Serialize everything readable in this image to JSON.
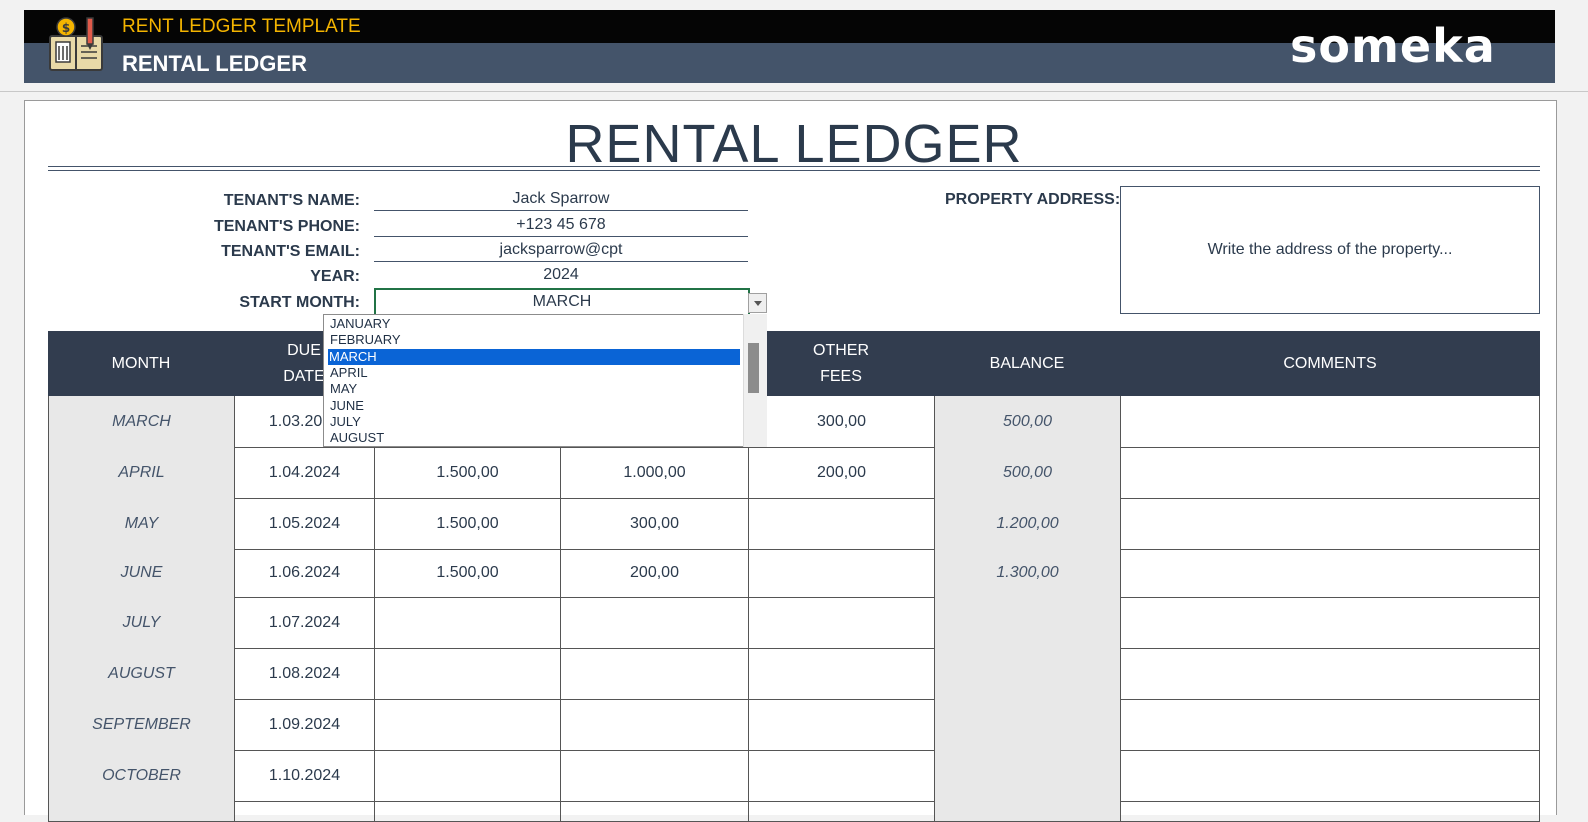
{
  "header": {
    "subtitle": "RENT LEDGER TEMPLATE",
    "title": "RENTAL LEDGER",
    "brand": "someka",
    "logo_icon": "ledger-book-icon"
  },
  "sheet_title": "RENTAL LEDGER",
  "tenant": {
    "name_label": "TENANT'S NAME:",
    "name": "Jack Sparrow",
    "phone_label": "TENANT'S PHONE:",
    "phone": "+123 45 678",
    "email_label": "TENANT'S EMAIL:",
    "email": "jacksparrow@cpt",
    "year_label": "YEAR:",
    "year": "2024",
    "start_month_label": "START MONTH:",
    "start_month": "MARCH"
  },
  "property": {
    "label": "PROPERTY ADDRESS:",
    "placeholder": "Write the address of the property..."
  },
  "table": {
    "headers": {
      "month": "MONTH",
      "due_date_1": "DUE",
      "due_date_2": "DATE",
      "other_fees_1": "OTHER",
      "other_fees_2": "FEES",
      "balance": "BALANCE",
      "comments": "COMMENTS"
    },
    "rows": [
      {
        "month": "MARCH",
        "due": "1.03.2024",
        "rent": "",
        "paid": "",
        "fees": "300,00",
        "balance": "500,00",
        "comments": ""
      },
      {
        "month": "APRIL",
        "due": "1.04.2024",
        "rent": "1.500,00",
        "paid": "1.000,00",
        "fees": "200,00",
        "balance": "500,00",
        "comments": ""
      },
      {
        "month": "MAY",
        "due": "1.05.2024",
        "rent": "1.500,00",
        "paid": "300,00",
        "fees": "",
        "balance": "1.200,00",
        "comments": ""
      },
      {
        "month": "JUNE",
        "due": "1.06.2024",
        "rent": "1.500,00",
        "paid": "200,00",
        "fees": "",
        "balance": "1.300,00",
        "comments": ""
      },
      {
        "month": "JULY",
        "due": "1.07.2024",
        "rent": "",
        "paid": "",
        "fees": "",
        "balance": "",
        "comments": ""
      },
      {
        "month": "AUGUST",
        "due": "1.08.2024",
        "rent": "",
        "paid": "",
        "fees": "",
        "balance": "",
        "comments": ""
      },
      {
        "month": "SEPTEMBER",
        "due": "1.09.2024",
        "rent": "",
        "paid": "",
        "fees": "",
        "balance": "",
        "comments": ""
      },
      {
        "month": "OCTOBER",
        "due": "1.10.2024",
        "rent": "",
        "paid": "",
        "fees": "",
        "balance": "",
        "comments": ""
      }
    ]
  },
  "dropdown": {
    "options": [
      "JANUARY",
      "FEBRUARY",
      "MARCH",
      "APRIL",
      "MAY",
      "JUNE",
      "JULY",
      "AUGUST"
    ],
    "selected": "MARCH"
  }
}
